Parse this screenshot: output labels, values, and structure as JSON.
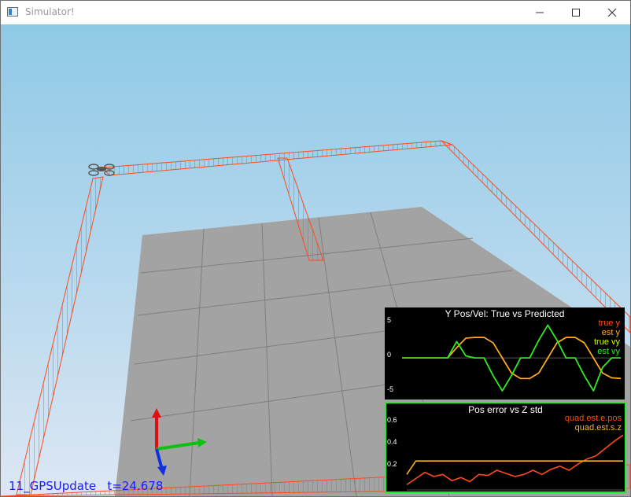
{
  "window": {
    "title": "Simulator!",
    "controls": [
      "minimize",
      "maximize",
      "close"
    ],
    "icon": "app-window-icon"
  },
  "status": {
    "scenario": "11_GPSUpdate",
    "time": "t=24.678"
  },
  "colors": {
    "sky_top": "#8fc9e6",
    "sky_bottom": "#dde9f5",
    "floor": "#9e9e9e",
    "trail": "#ff4a1a",
    "true_y": "#ff4a1a",
    "est_y": "#ffb21a",
    "true_vy": "#ccff00",
    "est_vy": "#22ee22",
    "border_highlight": "#22ee22",
    "status_text": "#1a1aff"
  },
  "plots": [
    {
      "title": "Y Pos/Vel: True vs Predicted",
      "yticks": [
        "5",
        "0",
        "-5"
      ],
      "legend": [
        {
          "label": "true y",
          "color": "#ff4a1a"
        },
        {
          "label": "est y",
          "color": "#ffb21a"
        },
        {
          "label": "true vy",
          "color": "#ccff00"
        },
        {
          "label": "est vy",
          "color": "#22ee22"
        }
      ]
    },
    {
      "title": "Pos error vs Z std",
      "yticks": [
        "0.6",
        "0.4",
        "0.2"
      ],
      "legend": [
        {
          "label": "quad.est.e.pos",
          "color": "#ff4a1a"
        },
        {
          "label": "quad.est.s.z",
          "color": "#ffb21a"
        }
      ]
    }
  ],
  "chart_data": [
    {
      "type": "line",
      "title": "Y Pos/Vel: True vs Predicted",
      "ylim": [
        -5.5,
        6
      ],
      "x": [
        0,
        1,
        2,
        3,
        4,
        5,
        6,
        7,
        8,
        9,
        10,
        11,
        12,
        13,
        14,
        15,
        16,
        17,
        18,
        19,
        20,
        21,
        22,
        23,
        24
      ],
      "series": [
        {
          "name": "true y",
          "values": [
            0,
            0,
            0,
            0,
            0,
            0,
            1.5,
            2.9,
            3,
            3,
            2.2,
            0,
            -2.2,
            -3,
            -3,
            -2.2,
            0,
            2.2,
            3,
            3,
            2.2,
            0,
            -2.2,
            -2.9,
            -3
          ]
        },
        {
          "name": "est y",
          "values": [
            0,
            0,
            0,
            0,
            0,
            0,
            1.5,
            2.9,
            3,
            3,
            2.2,
            0,
            -2.2,
            -3,
            -3,
            -2.2,
            0,
            2.2,
            3,
            3,
            2.2,
            0,
            -2.2,
            -2.9,
            -3
          ]
        },
        {
          "name": "true vy",
          "values": [
            0,
            0,
            0,
            0,
            0,
            0,
            2.4,
            0.3,
            0,
            0,
            -2.6,
            -4.8,
            -2.6,
            0,
            0,
            2.6,
            4.8,
            2.6,
            0,
            0,
            -2.6,
            -4.8,
            -1.4,
            0,
            0
          ]
        },
        {
          "name": "est vy",
          "values": [
            0,
            0,
            0,
            0,
            0,
            0,
            2.4,
            0.3,
            0,
            0,
            -2.6,
            -4.8,
            -2.6,
            0,
            0,
            2.6,
            4.8,
            2.6,
            0,
            0,
            -2.6,
            -4.8,
            -1.4,
            0,
            0
          ]
        }
      ]
    },
    {
      "type": "line",
      "title": "Pos error vs Z std",
      "ylim": [
        0.05,
        0.75
      ],
      "x": [
        0,
        1,
        2,
        3,
        4,
        5,
        6,
        7,
        8,
        9,
        10,
        11,
        12,
        13,
        14,
        15,
        16,
        17,
        18,
        19,
        20,
        21,
        22,
        23,
        24
      ],
      "series": [
        {
          "name": "quad.est.e.pos",
          "values": [
            0.1,
            0.16,
            0.22,
            0.18,
            0.2,
            0.14,
            0.17,
            0.13,
            0.2,
            0.19,
            0.24,
            0.21,
            0.18,
            0.2,
            0.24,
            0.2,
            0.25,
            0.28,
            0.24,
            0.3,
            0.35,
            0.38,
            0.45,
            0.52,
            0.58
          ]
        },
        {
          "name": "quad.est.s.z",
          "values": [
            0.2,
            0.33,
            0.33,
            0.33,
            0.33,
            0.33,
            0.33,
            0.33,
            0.33,
            0.33,
            0.33,
            0.33,
            0.33,
            0.33,
            0.33,
            0.33,
            0.33,
            0.33,
            0.33,
            0.33,
            0.33,
            0.33,
            0.33,
            0.33,
            0.33
          ]
        }
      ]
    }
  ]
}
